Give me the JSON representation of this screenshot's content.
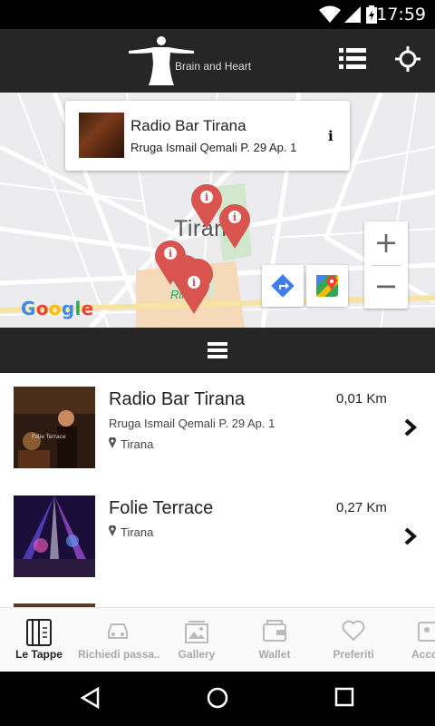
{
  "status": {
    "time": "17:59"
  },
  "header": {
    "logo_text": "Brain and Heart"
  },
  "map": {
    "card": {
      "name": "Radio Bar Tirana",
      "address": "Rruga Ismail Qemali P. 29 Ap. 1",
      "info_icon": "i"
    },
    "city_label": "Tirana",
    "district_label": "Rinia",
    "zoom_in": "+",
    "zoom_out": "−",
    "attribution": "Google"
  },
  "list": {
    "items": [
      {
        "name": "Radio Bar Tirana",
        "address": "Rruga Ismail Qemali P. 29 Ap. 1",
        "city": "Tirana",
        "distance": "0,01 Km"
      },
      {
        "name": "Folie Terrace",
        "address": "",
        "city": "Tirana",
        "distance": "0,27 Km"
      }
    ]
  },
  "tabs": [
    {
      "label": "Le Tappe",
      "icon": "map-book-icon",
      "active": true
    },
    {
      "label": "Richiedi passa..",
      "icon": "car-icon",
      "active": false
    },
    {
      "label": "Gallery",
      "icon": "image-icon",
      "active": false
    },
    {
      "label": "Wallet",
      "icon": "wallet-icon",
      "active": false
    },
    {
      "label": "Preferiti",
      "icon": "heart-icon",
      "active": false
    },
    {
      "label": "Acco",
      "icon": "account-icon",
      "active": false
    }
  ],
  "colors": {
    "pin": "#d9534f",
    "bar": "#262626",
    "active_tab": "#222222",
    "inactive_tab": "#a8a8a8"
  }
}
